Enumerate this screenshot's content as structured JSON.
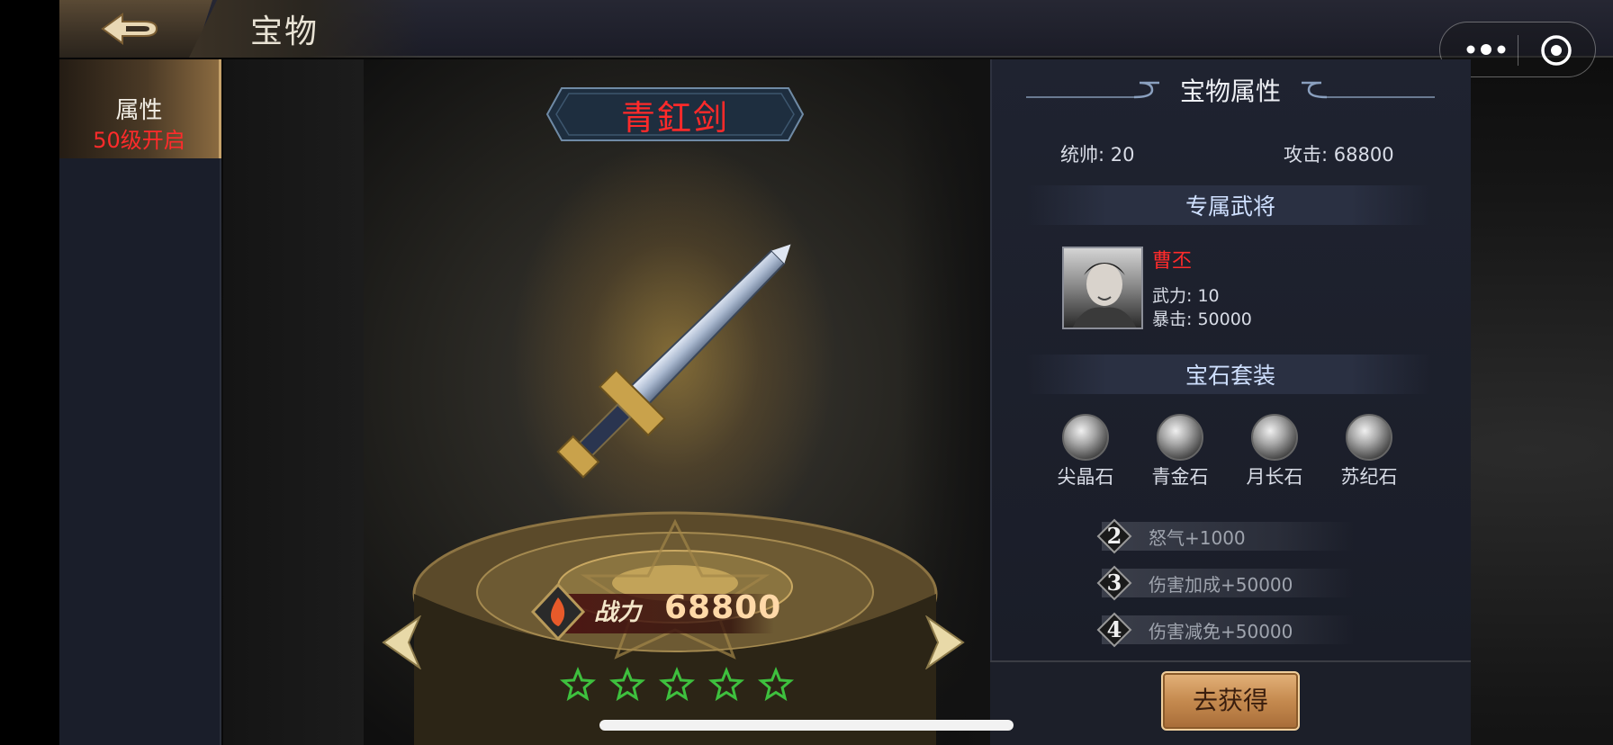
{
  "header": {
    "title": "宝物"
  },
  "sidebar": {
    "tab": {
      "label": "属性",
      "sublabel": "50级开启"
    }
  },
  "treasure": {
    "name": "青釭剑",
    "power_label": "战力",
    "power_value": "68800",
    "stars": 5
  },
  "panel": {
    "title": "宝物属性",
    "stats": [
      {
        "label": "统帅:",
        "value": "20"
      },
      {
        "label": "攻击:",
        "value": "68800"
      }
    ],
    "exclusive_section": "专属武将",
    "hero": {
      "name": "曹丕",
      "stats": [
        {
          "label": "武力:",
          "value": "10"
        },
        {
          "label": "暴击:",
          "value": "50000"
        }
      ]
    },
    "gem_section": "宝石套装",
    "gems": [
      "尖晶石",
      "青金石",
      "月长石",
      "苏纪石"
    ],
    "set_bonuses": [
      {
        "count": "2",
        "text": "怒气+1000"
      },
      {
        "count": "3",
        "text": "伤害加成+50000"
      },
      {
        "count": "4",
        "text": "伤害减免+50000"
      }
    ],
    "get_button": "去获得"
  },
  "colors": {
    "accent_red": "#ff2b2b",
    "gold": "#c58a4f",
    "star_green": "#3ec03e"
  }
}
